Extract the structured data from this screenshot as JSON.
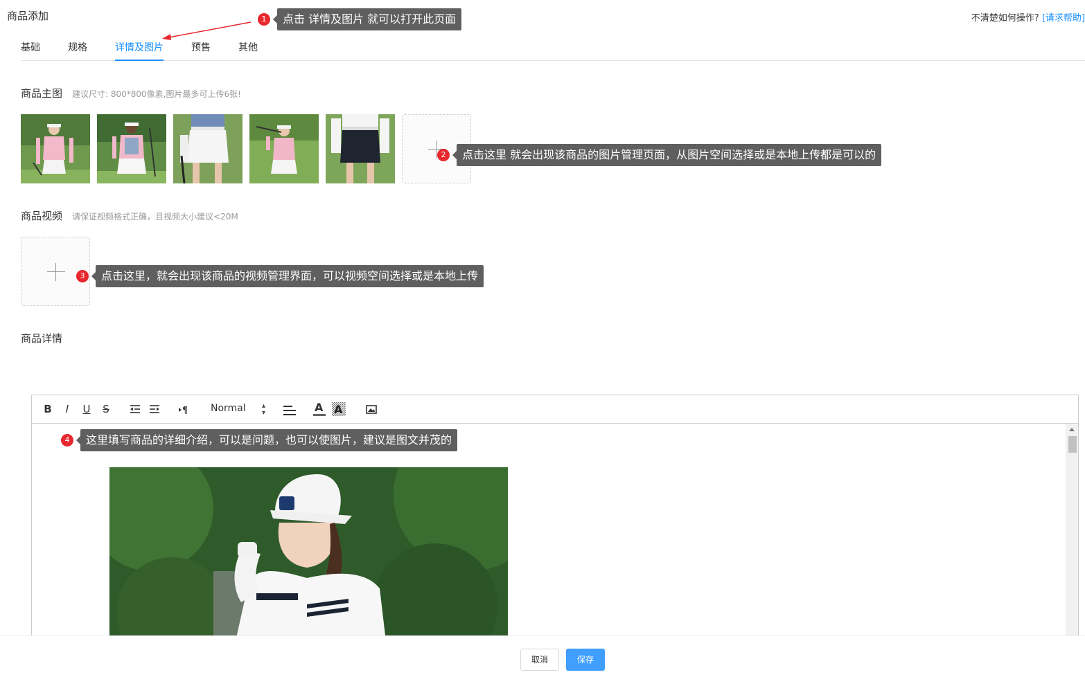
{
  "header": {
    "title": "商品添加",
    "help_prefix": "不清楚如何操作?",
    "help_link": "[请求帮助]"
  },
  "tabs": [
    {
      "label": "基础",
      "active": false
    },
    {
      "label": "规格",
      "active": false
    },
    {
      "label": "详情及图片",
      "active": true
    },
    {
      "label": "预售",
      "active": false
    },
    {
      "label": "其他",
      "active": false
    }
  ],
  "main_images": {
    "title": "商品主图",
    "hint": "建议尺寸: 800*800像素,图片最多可上传6张!"
  },
  "video": {
    "title": "商品视频",
    "hint": "请保证视频格式正确，且视频大小建议<20M"
  },
  "details": {
    "title": "商品详情"
  },
  "editor": {
    "toolbar": {
      "bold": "B",
      "italic": "I",
      "underline": "U",
      "strike": "S",
      "format_select": "Normal"
    }
  },
  "callouts": [
    {
      "num": "1",
      "text": "点击 详情及图片 就可以打开此页面"
    },
    {
      "num": "2",
      "text": "点击这里  就会出现该商品的图片管理页面，从图片空间选择或是本地上传都是可以的"
    },
    {
      "num": "3",
      "text": "点击这里，就会出现该商品的视频管理界面，可以视频空间选择或是本地上传"
    },
    {
      "num": "4",
      "text": "这里填写商品的详细介绍，可以是问题，也可以使图片，建议是图文并茂的"
    }
  ],
  "footer": {
    "cancel_label": "取消",
    "save_label": "保存"
  },
  "colors": {
    "accent": "#1890ff",
    "primary_button": "#409eff",
    "callout_bg": "#5f5f5f",
    "marker_red": "#e8272e"
  }
}
